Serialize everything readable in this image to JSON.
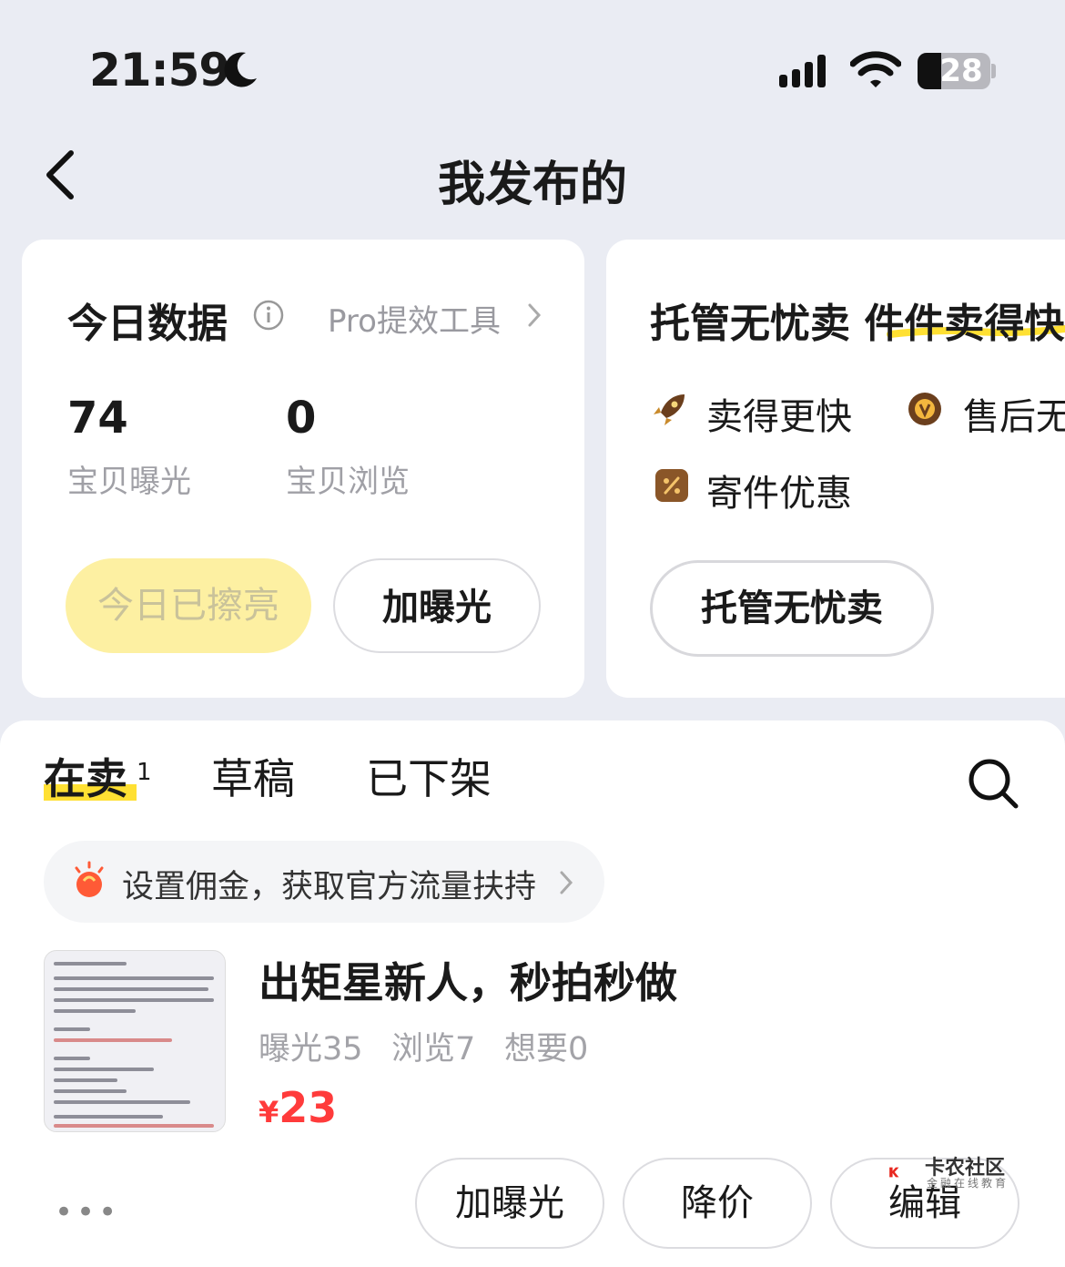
{
  "status_bar": {
    "time": "21:59",
    "battery": "28"
  },
  "header": {
    "title": "我发布的"
  },
  "today": {
    "title": "今日数据",
    "pro_link": "Pro提效工具",
    "stats": [
      {
        "value": "74",
        "label": "宝贝曝光"
      },
      {
        "value": "0",
        "label": "宝贝浏览"
      }
    ],
    "polished_button": "今日已擦亮",
    "boost_button": "加曝光"
  },
  "managed": {
    "title": "托管无忧卖 件件卖得快",
    "features": [
      "卖得更快",
      "售后无忧",
      "寄件优惠"
    ],
    "button": "托管无忧卖"
  },
  "tabs": {
    "items": [
      "在卖",
      "草稿",
      "已下架"
    ],
    "active_count": "1"
  },
  "banner": {
    "text": "设置佣金，获取官方流量扶持"
  },
  "item": {
    "title": "出矩星新人，秒拍秒做",
    "exposure": "曝光35",
    "views": "浏览7",
    "wants": "想要0",
    "currency": "¥",
    "price": "23",
    "actions": [
      "加曝光",
      "降价",
      "编辑"
    ],
    "more": "•••"
  },
  "watermark": {
    "text": "卡农社区",
    "sub": "金融在线教育"
  },
  "colors": {
    "accent_yellow": "#ffe033",
    "price_red": "#ff3b3b",
    "background": "#eaecf3"
  }
}
